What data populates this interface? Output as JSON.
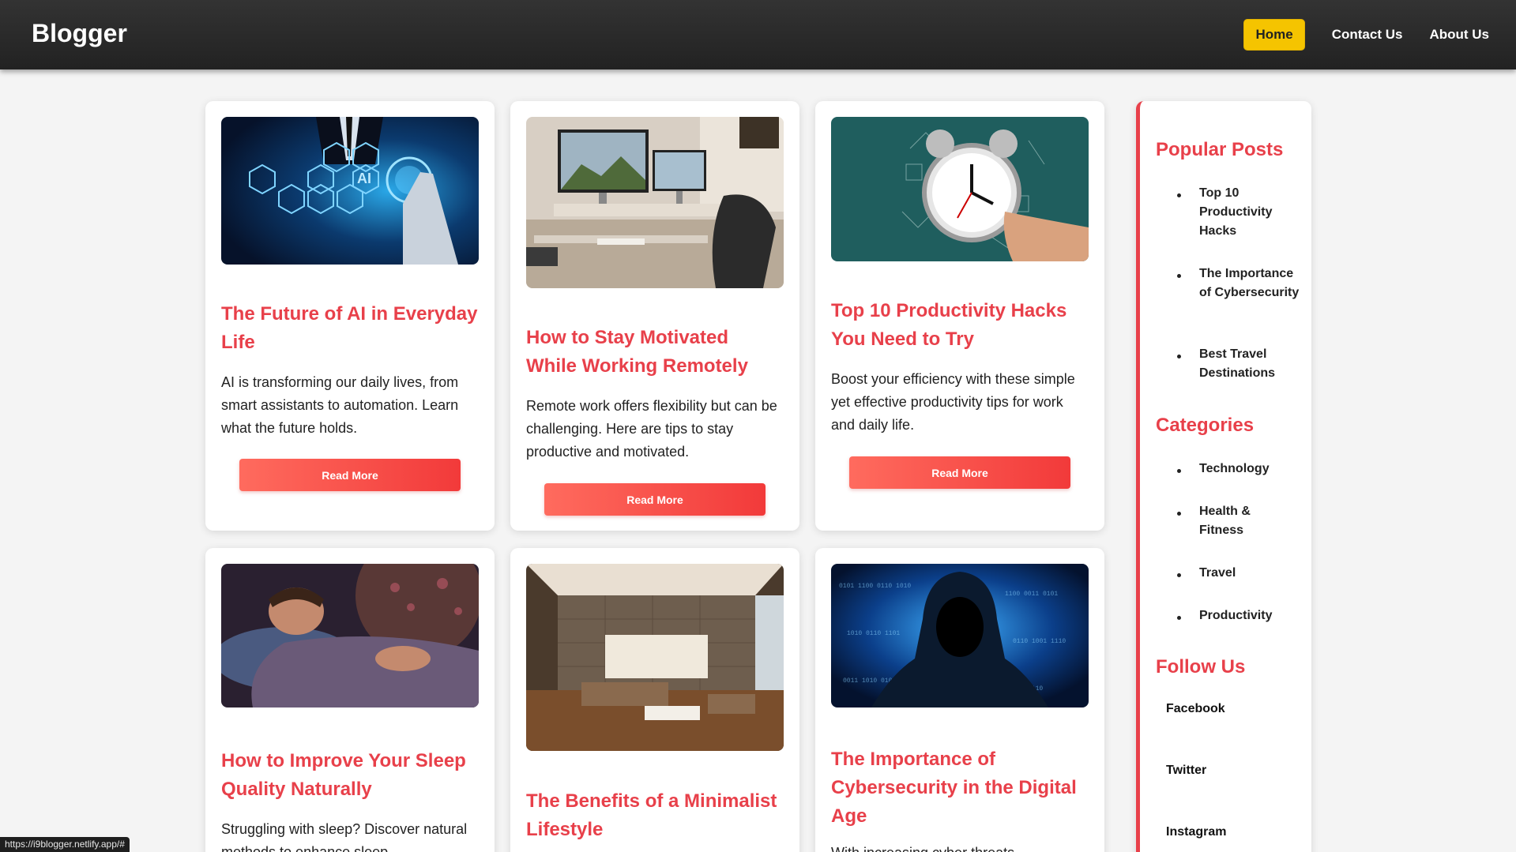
{
  "header": {
    "logo": "Blogger",
    "nav": [
      "Home",
      "Contact Us",
      "About Us"
    ]
  },
  "posts": [
    {
      "title": "The Future of AI in Everyday Life",
      "excerpt": "AI is transforming our daily lives, from smart assistants to automation. Learn what the future holds.",
      "button": "Read More",
      "image_icon": "ai-hand-icon"
    },
    {
      "title": "How to Stay Motivated While Working Remotely",
      "excerpt": "Remote work offers flexibility but can be challenging. Here are tips to stay productive and motivated.",
      "button": "Read More",
      "image_icon": "desk-computer-icon"
    },
    {
      "title": "Top 10 Productivity Hacks You Need to Try",
      "excerpt": "Boost your efficiency with these simple yet effective productivity tips for work and daily life.",
      "button": "Read More",
      "image_icon": "alarm-clock-icon"
    },
    {
      "title": "How to Improve Your Sleep Quality Naturally",
      "excerpt": "Struggling with sleep? Discover natural methods to enhance sleep",
      "image_icon": "sleeping-man-icon"
    },
    {
      "title": "The Benefits of a Minimalist Lifestyle",
      "image_icon": "minimalist-room-icon"
    },
    {
      "title": "The Importance of Cybersecurity in the Digital Age",
      "excerpt": "With increasing cyber threats",
      "image_icon": "hacker-hood-icon"
    }
  ],
  "sidebar": {
    "popular_heading": "Popular Posts",
    "popular": [
      "Top 10 Productivity Hacks",
      "The Importance of Cybersecurity",
      "Best Travel Destinations"
    ],
    "categories_heading": "Categories",
    "categories": [
      "Technology",
      "Health & Fitness",
      "Travel",
      "Productivity"
    ],
    "follow_heading": "Follow Us",
    "follow": [
      "Facebook",
      "Twitter",
      "Instagram"
    ]
  },
  "status_bar": "https://i9blogger.netlify.app/#",
  "colors": {
    "accent": "#e8404a",
    "nav_active": "#f5c400",
    "header_bg": "#2a2a2a"
  }
}
